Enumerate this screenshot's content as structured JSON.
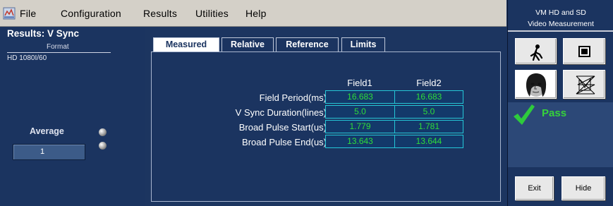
{
  "menubar": {
    "items": [
      "File",
      "Configuration",
      "Results",
      "Utilities",
      "Help"
    ]
  },
  "left": {
    "title": "Results: V Sync",
    "format_label": "Format",
    "format_value": "HD 1080I/60",
    "average_label": "Average",
    "average_value": "1"
  },
  "tabs": [
    "Measured",
    "Relative",
    "Reference",
    "Limits"
  ],
  "table": {
    "columns": [
      "Field1",
      "Field2"
    ],
    "rows": [
      {
        "label": "Field Period(ms)",
        "values": [
          "16.683",
          "16.683"
        ]
      },
      {
        "label": "V Sync Duration(lines)",
        "values": [
          "5.0",
          "5.0"
        ]
      },
      {
        "label": "Broad Pulse Start(us)",
        "values": [
          "1.779",
          "1.781"
        ]
      },
      {
        "label": "Broad Pulse End(us)",
        "values": [
          "13.643",
          "13.644"
        ]
      }
    ]
  },
  "right": {
    "title_line1": "VM HD and SD",
    "title_line2": "Video Measurement",
    "status": "Pass",
    "exit_label": "Exit",
    "hide_label": "Hide"
  },
  "colors": {
    "background": "#1b3460",
    "value_text": "#2edc3a",
    "cell_border": "#24c8d8",
    "pass": "#36d23a"
  },
  "icons": [
    "app-icon",
    "run-icon",
    "stop-icon",
    "face-icon",
    "waveform-icon",
    "checkmark-icon"
  ]
}
